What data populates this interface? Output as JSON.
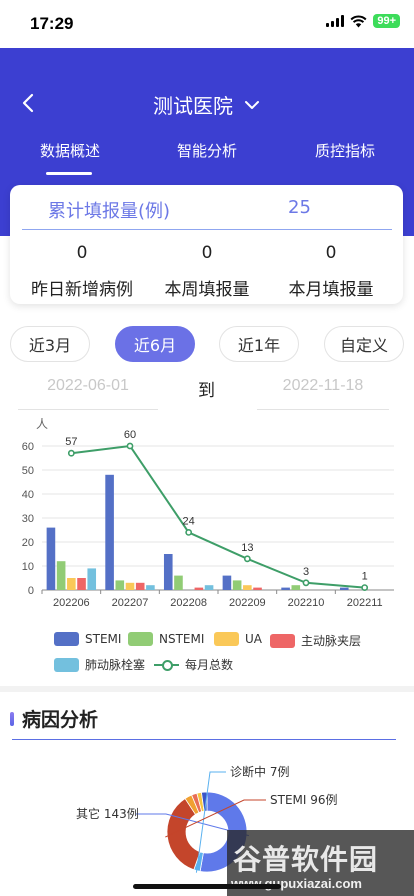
{
  "status": {
    "time": "17:29",
    "battery": "99+"
  },
  "header": {
    "title": "测试医院",
    "tabs": [
      {
        "label": "数据概述"
      },
      {
        "label": "智能分析"
      },
      {
        "label": "质控指标"
      }
    ],
    "active_tab": 0
  },
  "summary": {
    "cumulative_label": "累计填报量(例)",
    "cumulative_value": "25",
    "stats": [
      {
        "value": "0",
        "label": "昨日新增病例"
      },
      {
        "value": "0",
        "label": "本周填报量"
      },
      {
        "value": "0",
        "label": "本月填报量"
      }
    ]
  },
  "range": {
    "buttons": [
      {
        "label": "近3月"
      },
      {
        "label": "近6月"
      },
      {
        "label": "近1年"
      },
      {
        "label": "自定义"
      }
    ],
    "active_index": 1,
    "start_date": "2022-06-01",
    "to_label": "到",
    "end_date": "2022-11-18"
  },
  "chart_data": {
    "type": "bar",
    "ylabel": "人",
    "ylim": [
      0,
      60
    ],
    "y_ticks": [
      0,
      10,
      20,
      30,
      40,
      50,
      60
    ],
    "categories": [
      "202206",
      "202207",
      "202208",
      "202209",
      "202210",
      "202211"
    ],
    "series": [
      {
        "name": "STEMI",
        "type": "bar",
        "color": "#5470c6",
        "values": [
          26,
          48,
          15,
          6,
          1,
          1
        ]
      },
      {
        "name": "NSTEMI",
        "type": "bar",
        "color": "#91cc75",
        "values": [
          12,
          4,
          6,
          4,
          2,
          0
        ]
      },
      {
        "name": "UA",
        "type": "bar",
        "color": "#fac858",
        "values": [
          5,
          3,
          0,
          2,
          0,
          0
        ]
      },
      {
        "name": "主动脉夹层",
        "type": "bar",
        "color": "#ee6666",
        "values": [
          5,
          3,
          1,
          1,
          0,
          0
        ]
      },
      {
        "name": "肺动脉栓塞",
        "type": "bar",
        "color": "#73c0de",
        "values": [
          9,
          2,
          2,
          0,
          0,
          0
        ]
      },
      {
        "name": "每月总数",
        "type": "line",
        "color": "#3e9e68",
        "values": [
          57,
          60,
          24,
          13,
          3,
          1
        ]
      }
    ],
    "grid": true,
    "legend_position": "bottom"
  },
  "cause": {
    "title": "病因分析",
    "donut": {
      "slices": [
        {
          "label": "其它 143例",
          "value": 143,
          "color": "#5f79ea"
        },
        {
          "label": "诊断中 7例",
          "value": 7,
          "color": "#5ab1ef"
        },
        {
          "label": "STEMI 96例",
          "value": 96,
          "color": "#c4452b"
        },
        {
          "label": "",
          "value": 8,
          "color": "#f0a030"
        },
        {
          "label": "",
          "value": 6,
          "color": "#e86e56"
        },
        {
          "label": "",
          "value": 5,
          "color": "#f5c542"
        },
        {
          "label": "",
          "value": 6,
          "color": "#3a55c8"
        }
      ]
    }
  },
  "watermark": {
    "text": "谷普软件园",
    "url": "www.gupuxiazai.com"
  }
}
